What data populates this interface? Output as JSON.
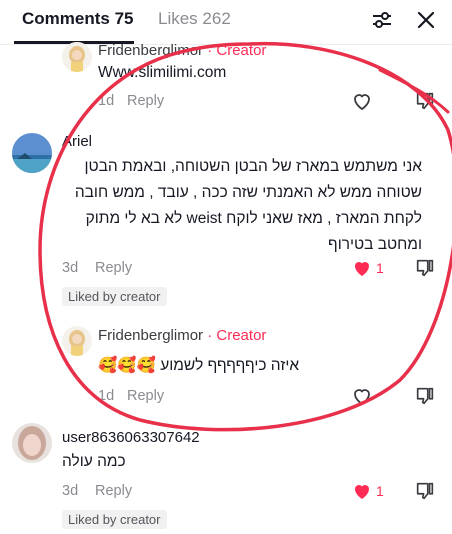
{
  "tabs": [
    {
      "label": "Comments 75"
    },
    {
      "label": "Likes 262"
    }
  ],
  "comments": [
    {
      "author": "Fridenberglimor",
      "creator_tag": "Creator",
      "text": "Www.slimilimi.com",
      "time": "1d",
      "reply": "Reply"
    },
    {
      "author": "Ariel",
      "lines": [
        "אני משתמש במארז של הבטן השטוחה, ובאמת הבטן",
        "שטוחה ממש לא האמנתי שזה ככה , עובד , ממש חובה",
        "לקחת המארז , מאז שאני לוקח weist לא בא לי מתוק",
        "ומחטב בטירוף"
      ],
      "time": "3d",
      "reply": "Reply",
      "likes": "1",
      "liked_badge": "Liked by creator"
    },
    {
      "author": "Fridenberglimor",
      "creator_tag": "Creator",
      "text": "🥰🥰🥰 איזה כיףףףףף לשמוע",
      "time": "1d",
      "reply": "Reply"
    },
    {
      "author": "user8636063307642",
      "text": "כמה עולה",
      "time": "3d",
      "reply": "Reply",
      "likes": "1",
      "liked_badge": "Liked by creator"
    }
  ],
  "colors": {
    "accent": "#fe2c55",
    "annotation": "#e8304a",
    "text": "#161823",
    "muted": "#8a8b91"
  },
  "icons": [
    "filter-icon",
    "close-icon",
    "heart-icon",
    "dislike-icon"
  ]
}
